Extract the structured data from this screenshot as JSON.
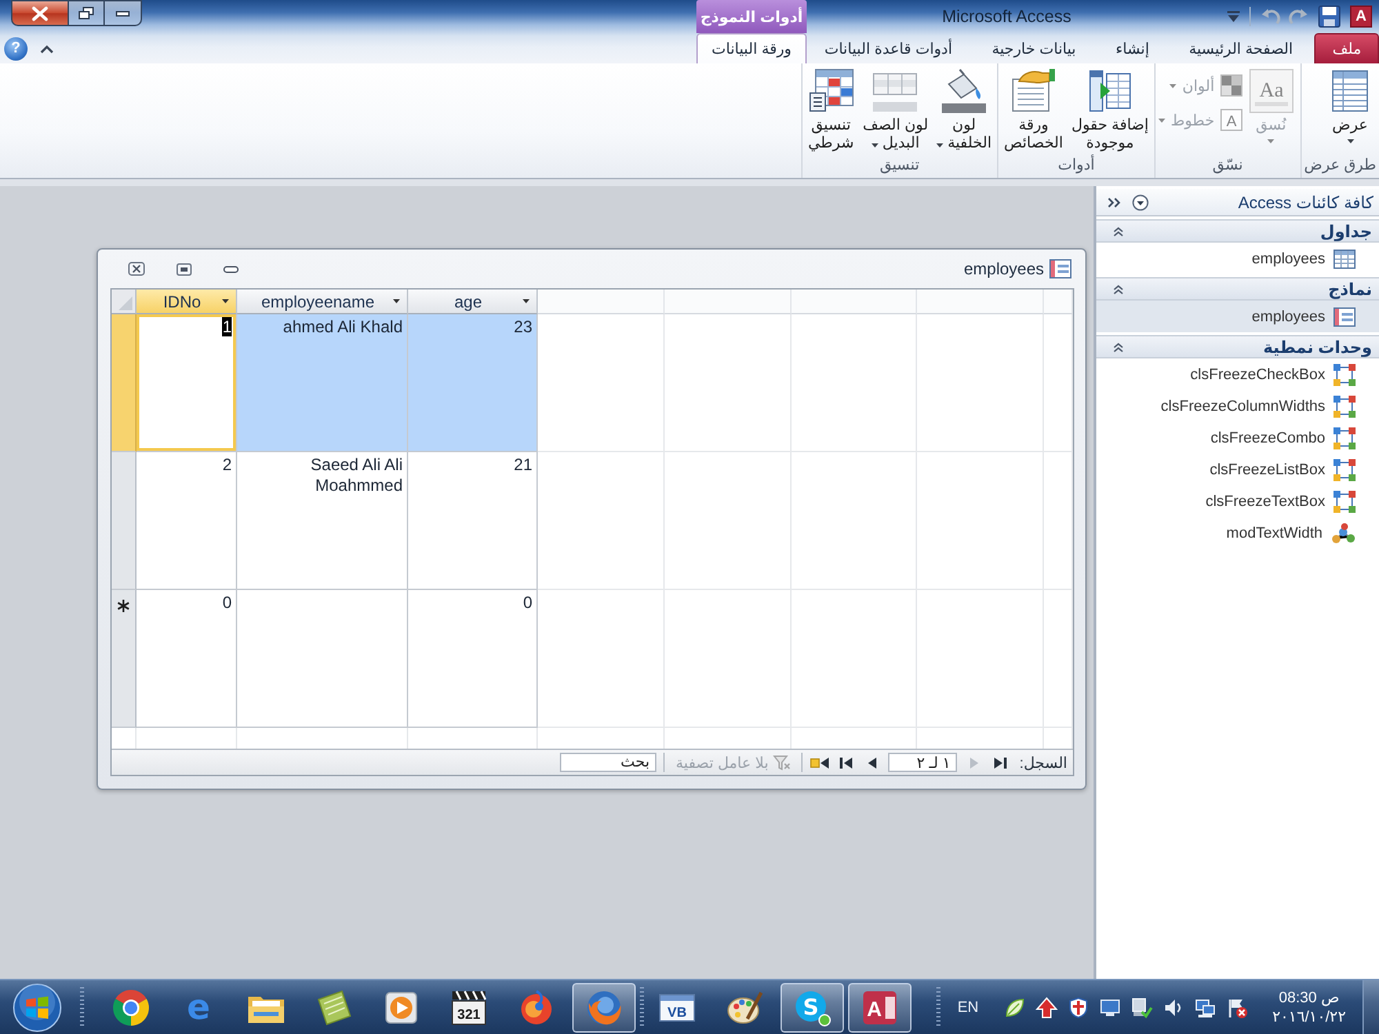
{
  "title_bar": {
    "title": "Microsoft Access",
    "app_icon": "A",
    "context_group": "أدوات النموذج"
  },
  "help": "?",
  "ribbon_tabs": [
    {
      "label": "ملف",
      "kind": "file",
      "selected": false
    },
    {
      "label": "الصفحة الرئيسية",
      "kind": "standard",
      "selected": false
    },
    {
      "label": "إنشاء",
      "kind": "standard",
      "selected": false
    },
    {
      "label": "بيانات خارجية",
      "kind": "standard",
      "selected": false
    },
    {
      "label": "أدوات قاعدة البيانات",
      "kind": "standard",
      "selected": false
    },
    {
      "label": "ورقة البيانات",
      "kind": "contextual",
      "selected": true
    }
  ],
  "ribbon_groups": [
    {
      "label": "طرق عرض",
      "commands": [
        {
          "kind": "large",
          "label": "عرض",
          "dropdown": true,
          "disabled": false
        }
      ]
    },
    {
      "label": "نسّق",
      "commands": [
        {
          "kind": "large",
          "label": "نُسق",
          "glyph": "Aa",
          "dropdown": true,
          "disabled": true
        },
        {
          "kind": "small",
          "label": "ألوان",
          "dropdown": true,
          "disabled": true
        },
        {
          "kind": "small",
          "label": "خطوط",
          "glyph": "A",
          "dropdown": true,
          "disabled": true
        }
      ]
    },
    {
      "label": "أدوات",
      "commands": [
        {
          "kind": "large",
          "label": "إضافة حقول\nموجودة",
          "dropdown": false,
          "disabled": false
        },
        {
          "kind": "large",
          "label": "ورقة\nالخصائص",
          "dropdown": false,
          "disabled": false
        }
      ]
    },
    {
      "label": "تنسيق",
      "commands": [
        {
          "kind": "large",
          "label": "لون\nالخلفية",
          "dropdown": true,
          "disabled": false
        },
        {
          "kind": "large",
          "label": "لون الصف\nالبديل",
          "dropdown": true,
          "disabled": false
        },
        {
          "kind": "large",
          "label": "تنسيق\nشرطي",
          "dropdown": false,
          "disabled": false
        }
      ]
    }
  ],
  "nav_pane": {
    "title": "كافة كائنات Access",
    "groups": [
      {
        "label": "جداول",
        "expanded": true,
        "items": [
          {
            "label": "employees",
            "kind": "table",
            "selected": false
          }
        ]
      },
      {
        "label": "نماذج",
        "expanded": true,
        "items": [
          {
            "label": "employees",
            "kind": "form",
            "selected": true
          }
        ]
      },
      {
        "label": "وحدات نمطية",
        "expanded": true,
        "items": [
          {
            "label": "clsFreezeCheckBox",
            "kind": "class_module",
            "selected": false
          },
          {
            "label": "clsFreezeColumnWidths",
            "kind": "class_module",
            "selected": false
          },
          {
            "label": "clsFreezeCombo",
            "kind": "class_module",
            "selected": false
          },
          {
            "label": "clsFreezeListBox",
            "kind": "class_module",
            "selected": false
          },
          {
            "label": "clsFreezeTextBox",
            "kind": "class_module",
            "selected": false
          },
          {
            "label": "modTextWidth",
            "kind": "module",
            "selected": false
          }
        ]
      }
    ]
  },
  "form": {
    "title": "employees",
    "columns": [
      {
        "label": "age",
        "selected": false
      },
      {
        "label": "employeename",
        "selected": false
      },
      {
        "label": "IDNo",
        "selected": true
      }
    ],
    "rows": [
      {
        "selected": true,
        "idno": "1",
        "employeename": "ahmed Ali Khald",
        "age": "23"
      },
      {
        "selected": false,
        "idno": "2",
        "employeename": "Saeed Ali Ali Moahmmed",
        "age": "21"
      }
    ],
    "new_row": {
      "idno": "0",
      "age": "0"
    },
    "record_nav": {
      "label": "السجل:",
      "leading_buttons": [
        {
          "kind": "first",
          "disabled": false
        },
        {
          "kind": "previous",
          "disabled": true
        }
      ],
      "position": "١ لـ ٢",
      "trailing_buttons": [
        {
          "kind": "next",
          "disabled": false
        },
        {
          "kind": "last",
          "disabled": false
        },
        {
          "kind": "new",
          "disabled": false
        }
      ],
      "filter": {
        "label": "بلا عامل تصفية",
        "disabled": true
      },
      "search": {
        "placeholder": "بحث"
      }
    }
  },
  "taskbar": {
    "running": [
      {
        "kind": "access",
        "text": "A",
        "active": true
      },
      {
        "kind": "skype",
        "text": "S",
        "active": true
      },
      {
        "kind": "palette",
        "active": false
      },
      {
        "kind": "vb",
        "text": "VB",
        "active": false
      }
    ],
    "quick_launch": [
      {
        "kind": "firefox",
        "active": true
      },
      {
        "kind": "swirl",
        "active": false
      },
      {
        "kind": "clapper",
        "text": "321",
        "active": false
      },
      {
        "kind": "media",
        "active": false
      },
      {
        "kind": "notepad",
        "active": false
      },
      {
        "kind": "folder",
        "active": false
      },
      {
        "kind": "ie",
        "text": "e",
        "active": false
      },
      {
        "kind": "chrome",
        "active": false
      }
    ],
    "language": "EN",
    "time": "08:30 ص",
    "date": "٢٠١٦/١٠/٢٢"
  }
}
